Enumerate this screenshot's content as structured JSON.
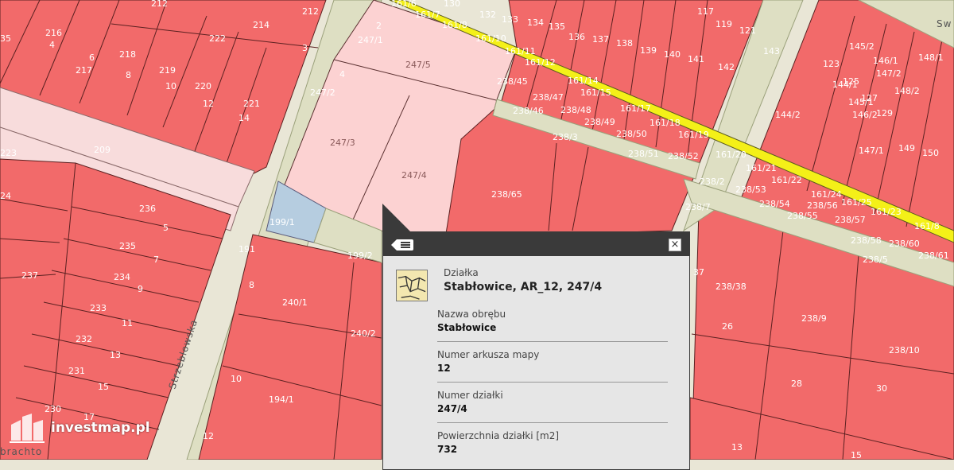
{
  "map": {
    "colors": {
      "background": "#e9e6d6",
      "parcel": "#f26a6a",
      "parcel_border": "#5a2020",
      "selected_parcel": "#fcd2d2",
      "road": "#dedfc3",
      "road_border": "#9aa07a",
      "water_parcel": "#b6cde0",
      "highlight_strip": "#f4f018"
    },
    "street_names": [
      "Strzeblowska",
      "brachto",
      "Sw"
    ],
    "parcel_labels": [
      "212",
      "216",
      "4",
      "218",
      "6",
      "217",
      "8",
      "219",
      "10",
      "220",
      "12",
      "221",
      "14",
      "222",
      "214",
      "3",
      "247/1",
      "2",
      "247/5",
      "247/2",
      "247/3",
      "247/4",
      "4",
      "209",
      "223",
      "24",
      "236",
      "5",
      "235",
      "7",
      "234",
      "9",
      "233",
      "11",
      "232",
      "13",
      "231",
      "15",
      "230",
      "17",
      "237",
      "199/1",
      "199/2",
      "191",
      "8",
      "240/1",
      "240/2",
      "10",
      "194/1",
      "12",
      "161/6",
      "161/7",
      "161/8",
      "130",
      "132",
      "133",
      "134",
      "135",
      "136",
      "137",
      "138",
      "139",
      "140",
      "141",
      "142",
      "117",
      "119",
      "121",
      "161/10",
      "161/11",
      "161/12",
      "161/14",
      "161/15",
      "161/17",
      "161/18",
      "161/19",
      "161/20",
      "161/21",
      "161/22",
      "161/24",
      "161/25",
      "161/23",
      "161/8",
      "238/45",
      "238/47",
      "238/48",
      "238/46",
      "238/49",
      "238/50",
      "238/51",
      "238/52",
      "238/3",
      "238/65",
      "238/2",
      "238/53",
      "238/54",
      "238/7",
      "238/55",
      "238/56",
      "238/57",
      "238/58",
      "238/60",
      "238/61",
      "238/5",
      "238/38",
      "238/9",
      "238/10",
      "26",
      "28",
      "30",
      "13",
      "15",
      "37",
      "143",
      "145/2",
      "146/1",
      "147/2",
      "148/1",
      "123",
      "125",
      "127",
      "129",
      "144/1",
      "145/1",
      "146/2",
      "148/2",
      "144/2",
      "147/1",
      "149",
      "150"
    ],
    "selected_parcel_label": "247/4"
  },
  "popup": {
    "type_label": "Działka",
    "title": "Stabłowice, AR_12, 247/4",
    "fields": [
      {
        "label": "Nazwa obrębu",
        "value": "Stabłowice"
      },
      {
        "label": "Numer arkusza mapy",
        "value": "12"
      },
      {
        "label": "Numer działki",
        "value": "247/4"
      },
      {
        "label": "Powierzchnia działki [m2]",
        "value": "732"
      }
    ],
    "icons": {
      "list": "list-icon",
      "close": "close-icon",
      "parcel": "parcel-map-icon"
    },
    "close_glyph": "×"
  },
  "watermark": {
    "text": "investmap.pl"
  }
}
